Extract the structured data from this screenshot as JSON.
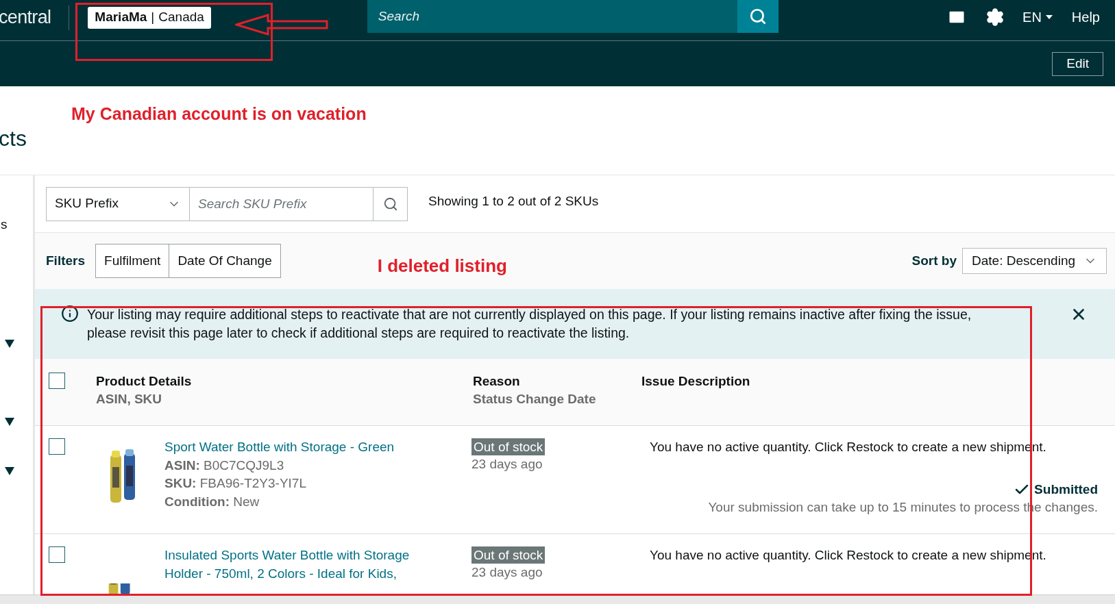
{
  "header": {
    "logo_text": "central",
    "account": {
      "name": "MariaMa",
      "separator": "|",
      "region": "Canada"
    },
    "search": {
      "placeholder": "Search"
    },
    "language": "EN",
    "help": "Help"
  },
  "subheader": {
    "edit_button": "Edit"
  },
  "page_title": "cts",
  "annotations": [
    {
      "text": "My Canadian account is on vacation"
    },
    {
      "text": "I deleted listing"
    }
  ],
  "sidebar": {
    "items": [
      {
        "label": "s"
      }
    ]
  },
  "search_row": {
    "select_value": "SKU Prefix",
    "placeholder": "Search SKU Prefix",
    "summary": "Showing 1 to 2 out of 2 SKUs"
  },
  "filters": {
    "label": "Filters",
    "buttons": [
      "Fulfilment",
      "Date Of Change"
    ],
    "sort_label": "Sort by",
    "sort_value": "Date: Descending"
  },
  "banner": {
    "text": "Your listing may require additional steps to reactivate that are not currently displayed on this page. If your listing remains inactive after fixing the issue, please revisit this page later to check if additional steps are required to reactivate the listing."
  },
  "table": {
    "header_checked": false,
    "columns": [
      {
        "title": "Product Details",
        "subtitle": "ASIN, SKU"
      },
      {
        "title": "Reason",
        "subtitle": "Status Change Date"
      },
      {
        "title": "Issue Description"
      }
    ],
    "rows": [
      {
        "checked": false,
        "title": "Sport Water Bottle with Storage - Green",
        "details": [
          {
            "label": "ASIN:",
            "value": "B0C7CQJ9L3"
          },
          {
            "label": "SKU:",
            "value": "FBA96-T2Y3-YI7L"
          },
          {
            "label": "Condition:",
            "value": "New"
          }
        ],
        "reason": "Out of stock",
        "date": "23 days ago",
        "issue": "You have no active quantity. Click Restock to create a new shipment.",
        "status": {
          "label": "Submitted",
          "note": "Your submission can take up to 15 minutes to process the changes."
        }
      },
      {
        "checked": false,
        "title": "Insulated Sports Water Bottle with Storage Holder - 750ml, 2 Colors - Ideal for Kids,",
        "details": [],
        "reason": "Out of stock",
        "date": "23 days ago",
        "issue": "You have no active quantity. Click Restock to create a new shipment."
      }
    ]
  }
}
